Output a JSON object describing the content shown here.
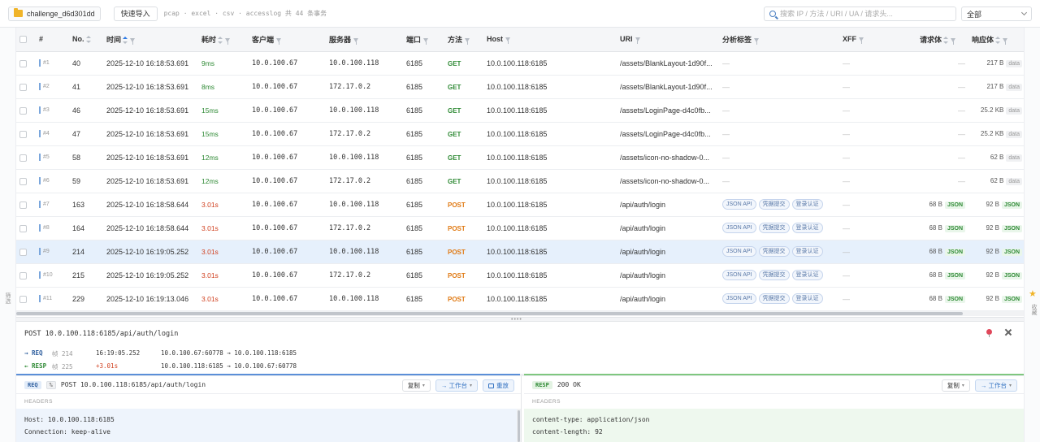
{
  "topbar": {
    "file_name": "challenge_d6d301dd",
    "import_label": "快速导入",
    "info": "pcap · excel · csv · accesslog 共 44 条事务",
    "search_placeholder": "搜索 IP / 方法 / URI / UA / 请求头...",
    "filter_value": "全部"
  },
  "rails": {
    "left_label": "筛选",
    "right_label": "收藏"
  },
  "table": {
    "headers": {
      "idx": "#",
      "no": "No.",
      "time": "时间",
      "dur": "耗时",
      "client": "客户端",
      "server": "服务器",
      "port": "端口",
      "method": "方法",
      "host": "Host",
      "uri": "URI",
      "tags": "分析标签",
      "xff": "XFF",
      "req": "请求体",
      "resp": "响应体"
    },
    "dash": "—",
    "rows": [
      {
        "idx": "#1",
        "no": "40",
        "time": "2025-12-10 16:18:53.691",
        "dur": "9ms",
        "client": "10.0.100.67",
        "server": "10.0.100.118",
        "port": "6185",
        "method": "GET",
        "host": "10.0.100.118:6185",
        "uri": "/assets/BlankLayout-1d90f...",
        "req": "—",
        "resp": "217 B",
        "resp_type": "data"
      },
      {
        "idx": "#2",
        "no": "41",
        "time": "2025-12-10 16:18:53.691",
        "dur": "8ms",
        "client": "10.0.100.67",
        "server": "172.17.0.2",
        "port": "6185",
        "method": "GET",
        "host": "10.0.100.118:6185",
        "uri": "/assets/BlankLayout-1d90f...",
        "req": "—",
        "resp": "217 B",
        "resp_type": "data"
      },
      {
        "idx": "#3",
        "no": "46",
        "time": "2025-12-10 16:18:53.691",
        "dur": "15ms",
        "client": "10.0.100.67",
        "server": "10.0.100.118",
        "port": "6185",
        "method": "GET",
        "host": "10.0.100.118:6185",
        "uri": "/assets/LoginPage-d4c0fb...",
        "req": "—",
        "resp": "25.2 KB",
        "resp_type": "data"
      },
      {
        "idx": "#4",
        "no": "47",
        "time": "2025-12-10 16:18:53.691",
        "dur": "15ms",
        "client": "10.0.100.67",
        "server": "172.17.0.2",
        "port": "6185",
        "method": "GET",
        "host": "10.0.100.118:6185",
        "uri": "/assets/LoginPage-d4c0fb...",
        "req": "—",
        "resp": "25.2 KB",
        "resp_type": "data"
      },
      {
        "idx": "#5",
        "no": "58",
        "time": "2025-12-10 16:18:53.691",
        "dur": "12ms",
        "client": "10.0.100.67",
        "server": "10.0.100.118",
        "port": "6185",
        "method": "GET",
        "host": "10.0.100.118:6185",
        "uri": "/assets/icon-no-shadow-0...",
        "req": "—",
        "resp": "62 B",
        "resp_type": "data"
      },
      {
        "idx": "#6",
        "no": "59",
        "time": "2025-12-10 16:18:53.691",
        "dur": "12ms",
        "client": "10.0.100.67",
        "server": "172.17.0.2",
        "port": "6185",
        "method": "GET",
        "host": "10.0.100.118:6185",
        "uri": "/assets/icon-no-shadow-0...",
        "req": "—",
        "resp": "62 B",
        "resp_type": "data"
      },
      {
        "idx": "#7",
        "no": "163",
        "time": "2025-12-10 16:18:58.644",
        "dur": "3.01s",
        "client": "10.0.100.67",
        "server": "10.0.100.118",
        "port": "6185",
        "method": "POST",
        "host": "10.0.100.118:6185",
        "uri": "/api/auth/login",
        "req": "68 B",
        "req_type": "JSON",
        "resp": "92 B",
        "resp_type": "JSON"
      },
      {
        "idx": "#8",
        "no": "164",
        "time": "2025-12-10 16:18:58.644",
        "dur": "3.01s",
        "client": "10.0.100.67",
        "server": "172.17.0.2",
        "port": "6185",
        "method": "POST",
        "host": "10.0.100.118:6185",
        "uri": "/api/auth/login",
        "req": "68 B",
        "req_type": "JSON",
        "resp": "92 B",
        "resp_type": "JSON"
      },
      {
        "idx": "#9",
        "no": "214",
        "time": "2025-12-10 16:19:05.252",
        "dur": "3.01s",
        "client": "10.0.100.67",
        "server": "10.0.100.118",
        "port": "6185",
        "method": "POST",
        "host": "10.0.100.118:6185",
        "uri": "/api/auth/login",
        "req": "68 B",
        "req_type": "JSON",
        "resp": "92 B",
        "resp_type": "JSON",
        "selected": true
      },
      {
        "idx": "#10",
        "no": "215",
        "time": "2025-12-10 16:19:05.252",
        "dur": "3.01s",
        "client": "10.0.100.67",
        "server": "172.17.0.2",
        "port": "6185",
        "method": "POST",
        "host": "10.0.100.118:6185",
        "uri": "/api/auth/login",
        "req": "68 B",
        "req_type": "JSON",
        "resp": "92 B",
        "resp_type": "JSON"
      },
      {
        "idx": "#11",
        "no": "229",
        "time": "2025-12-10 16:19:13.046",
        "dur": "3.01s",
        "client": "10.0.100.67",
        "server": "10.0.100.118",
        "port": "6185",
        "method": "POST",
        "host": "10.0.100.118:6185",
        "uri": "/api/auth/login",
        "req": "68 B",
        "req_type": "JSON",
        "resp": "92 B",
        "resp_type": "JSON"
      }
    ],
    "post_tags": [
      "JSON API",
      "凭据提交",
      "登录认证"
    ]
  },
  "detail": {
    "title": "POST 10.0.100.118:6185/api/auth/login",
    "req_flow": {
      "key": "→ REQ",
      "num": "帧 214",
      "time": "16:19:05.252",
      "endpoints": "10.0.100.67:60778 → 10.0.100.118:6185"
    },
    "resp_flow": {
      "key": "← RESP",
      "num": "帧 225",
      "time": "+3.01s",
      "endpoints": "10.0.100.118:6185 → 10.0.100.67:60778"
    },
    "req_pane": {
      "badge": "REQ",
      "pct": "%",
      "line": "POST 10.0.100.118:6185/api/auth/login",
      "copy": "复制",
      "workbench": "→ 工作台",
      "replay": "重放",
      "section": "HEADERS",
      "headers": [
        "Host: 10.0.100.118:6185",
        "Connection: keep-alive"
      ]
    },
    "resp_pane": {
      "badge": "RESP",
      "line": "200 OK",
      "copy": "复制",
      "workbench": "→ 工作台",
      "section": "HEADERS",
      "headers": [
        "content-type: application/json",
        "content-length: 92"
      ]
    }
  },
  "colors": {
    "accent": "#2f7be5",
    "get": "#2f8a35",
    "post": "#e07a14",
    "slow": "#d0401f"
  }
}
